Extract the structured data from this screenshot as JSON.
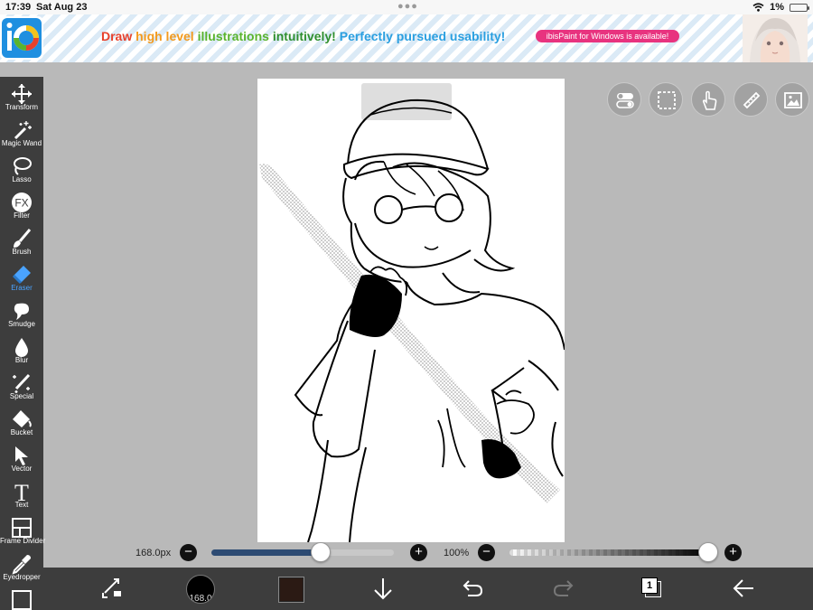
{
  "status_bar": {
    "time": "17:39",
    "date": "Sat Aug 23",
    "battery": "1%"
  },
  "banner": {
    "headline_parts": [
      {
        "text": "Draw ",
        "color": "#e8412c"
      },
      {
        "text": "high level ",
        "color": "#f39a1e"
      },
      {
        "text": "illustrations ",
        "color": "#5ab42e"
      },
      {
        "text": "intuitively! ",
        "color": "#2f8f2f"
      },
      {
        "text": "Perfectly pursued usability!",
        "color": "#2a9fe0"
      }
    ],
    "pill": "ibisPaint for Windows is available!"
  },
  "tools": [
    {
      "label": "Transform",
      "icon": "move-arrows-icon"
    },
    {
      "label": "Magic Wand",
      "icon": "magic-wand-icon"
    },
    {
      "label": "Lasso",
      "icon": "lasso-icon"
    },
    {
      "label": "Filter",
      "icon": "fx-icon"
    },
    {
      "label": "Brush",
      "icon": "brush-icon"
    },
    {
      "label": "Eraser",
      "icon": "eraser-icon",
      "active": true
    },
    {
      "label": "Smudge",
      "icon": "smudge-icon"
    },
    {
      "label": "Blur",
      "icon": "blur-drop-icon"
    },
    {
      "label": "Special",
      "icon": "special-pen-icon"
    },
    {
      "label": "Bucket",
      "icon": "bucket-icon"
    },
    {
      "label": "Vector",
      "icon": "vector-arrow-icon"
    },
    {
      "label": "Text",
      "icon": "text-icon"
    },
    {
      "label": "Frame Divider",
      "icon": "frame-divider-icon"
    },
    {
      "label": "Eyedropper",
      "icon": "eyedropper-icon"
    }
  ],
  "brush": {
    "size_label": "168.0px",
    "size_fraction": 0.6,
    "opacity_label": "100%",
    "opacity_fraction": 1.0,
    "size_badge": "168.0"
  },
  "colors": {
    "accent": "#4aa3ff",
    "current_color": "#2b1a14",
    "slider_fill": "#2d4b73",
    "toolbar_bg": "#3d3d3d",
    "canvas_bg": "#b9b9b9"
  },
  "layers": {
    "count": "1"
  }
}
